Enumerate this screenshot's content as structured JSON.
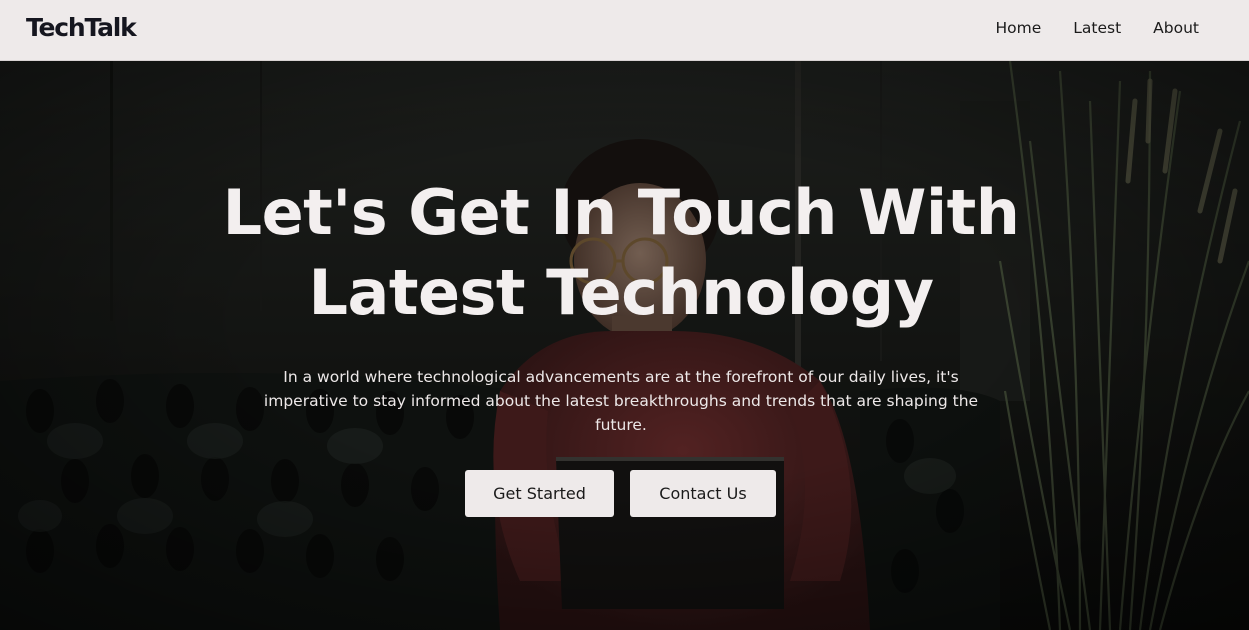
{
  "brand": {
    "name": "TechTalk"
  },
  "nav": {
    "links": [
      {
        "label": "Home"
      },
      {
        "label": "Latest"
      },
      {
        "label": "About"
      }
    ]
  },
  "hero": {
    "headline_line1": "Let's Get In Touch With",
    "headline_line2": "Latest Technology",
    "subtext": "In a world where technological advancements are at the forefront of our daily lives, it's imperative to stay informed about the latest breakthroughs and trends that are shaping the future.",
    "primary_button": "Get Started",
    "secondary_button": "Contact Us",
    "background_image": "person-with-laptop-photo"
  },
  "colors": {
    "navbar_bg": "#eeeaea",
    "brand_text": "#15161f",
    "hero_text": "#f3efef",
    "button_bg": "#eeeaea"
  }
}
